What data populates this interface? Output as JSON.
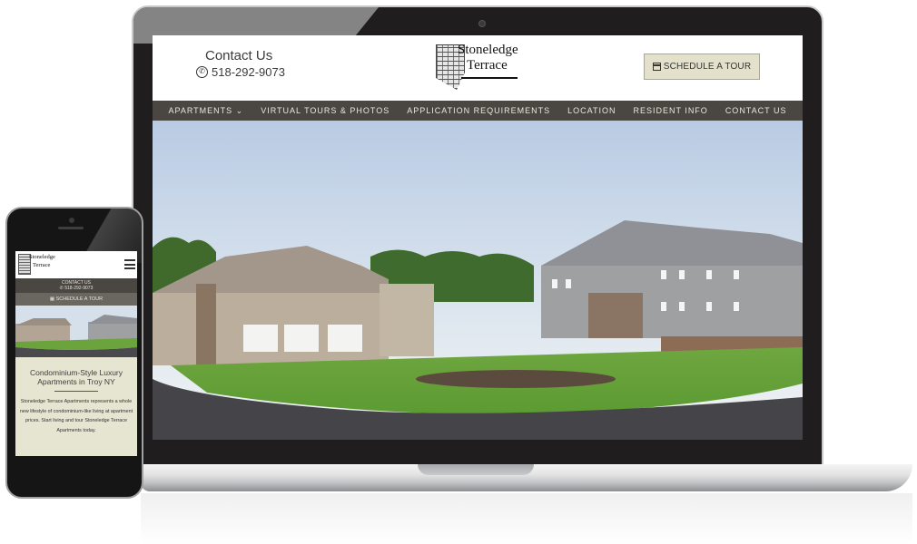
{
  "desktop": {
    "header": {
      "contact_title": "Contact Us",
      "phone": "518-292-9073",
      "logo_line1": "Stoneledge",
      "logo_line2": "Terrace",
      "schedule_button": "SCHEDULE A TOUR"
    },
    "nav": {
      "items": [
        {
          "label": "APARTMENTS ⌄"
        },
        {
          "label": "VIRTUAL TOURS & PHOTOS"
        },
        {
          "label": "APPLICATION REQUIREMENTS"
        },
        {
          "label": "LOCATION"
        },
        {
          "label": "RESIDENT INFO"
        },
        {
          "label": "CONTACT US"
        }
      ]
    },
    "hero": {
      "alt": "Stoneledge Terrace apartment buildings with landscaped lawn"
    }
  },
  "mobile": {
    "logo_line1": "Stoneledge",
    "logo_line2": "Terrace",
    "contact_label": "CONTACT US",
    "phone": "✆ 518-292-9073",
    "schedule_button": "▦ SCHEDULE A TOUR",
    "title": "Condominium-Style Luxury Apartments in Troy NY",
    "body": "Stoneledge Terrace Apartments represents a whole new lifestyle of condominium-like living at apartment prices. Start living and tour Stoneledge Terrace Apartments today."
  },
  "colors": {
    "nav_bg": "#4a4742",
    "button_bg": "#e3e1cc",
    "content_bg": "#e6e5d2",
    "device_frame": "#1f1d1e"
  }
}
